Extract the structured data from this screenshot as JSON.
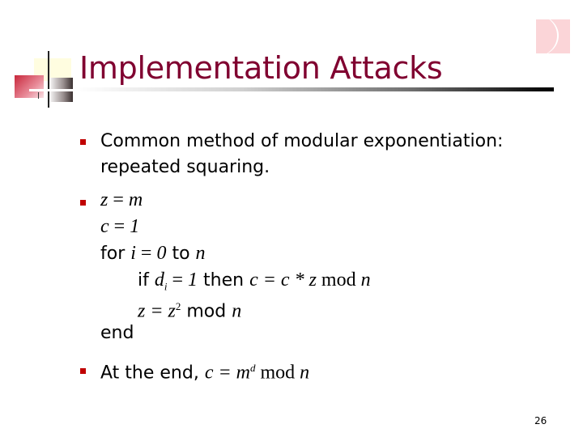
{
  "slide": {
    "title": "Implementation Attacks",
    "page_number": "26",
    "colors": {
      "title": "#800030",
      "bullet": "#c00000"
    },
    "bullets": [
      {
        "icon": "square-bullet",
        "lines": [
          "Common method of modular exponentiation:",
          "repeated squaring."
        ]
      },
      {
        "icon": "square-bullet",
        "code": {
          "z_assign": {
            "var": "z",
            "eq": " = ",
            "val": "m"
          },
          "c_assign": {
            "var": "c",
            "eq": " = ",
            "val": "1"
          },
          "for_line": {
            "kw_for": "for ",
            "var": "i",
            "eq": " = ",
            "start": "0",
            "kw_to": " to ",
            "end": "n"
          },
          "if_line": {
            "kw_if": "if ",
            "d": "d",
            "sub": "i",
            "eq": " = ",
            "one": "1",
            "kw_then": " then ",
            "expr": "c = c * z",
            "mod": " mod ",
            "n": "n"
          },
          "z_line": {
            "lhs": "z = z",
            "exp": "2",
            "mod": " mod ",
            "n": "n"
          },
          "end": "end"
        }
      },
      {
        "icon": "square-bullet",
        "prefix": "At the end, ",
        "expr_lhs": "c = m",
        "exp": "d",
        "mod": " mod ",
        "n": "n"
      }
    ]
  }
}
